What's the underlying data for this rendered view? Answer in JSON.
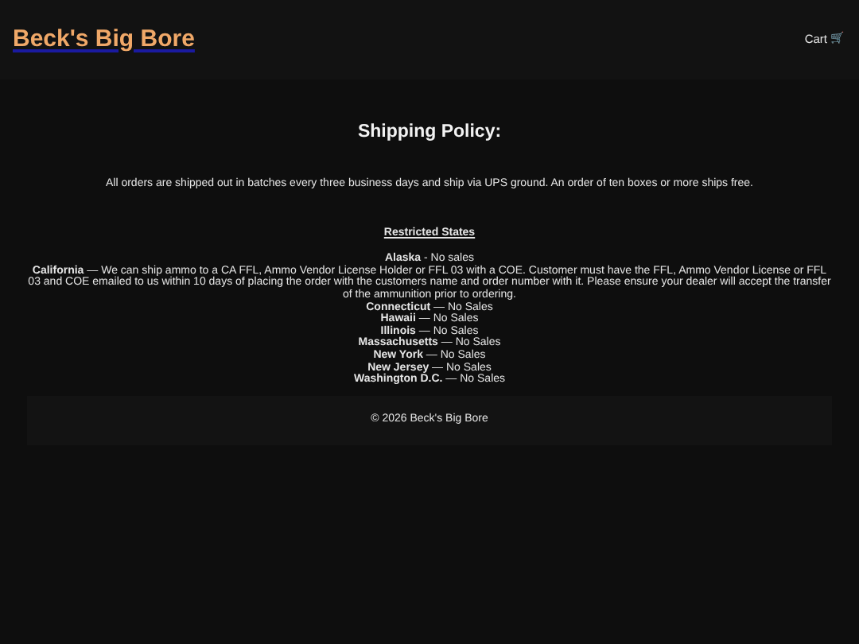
{
  "header": {
    "logo": "Beck's Big Bore",
    "cart": "Cart",
    "cart_icon": "🛒"
  },
  "title": "Shipping Policy:",
  "intro": "All orders are shipped out in batches every three business days and ship via UPS ground. An order of ten boxes or more ships free.",
  "restricted_heading": "Restricted States",
  "restrictions": [
    "**Alaska** - No sales",
    "**California** — We can ship ammo to a CA FFL, Ammo Vendor License Holder or FFL 03 with a COE. Customer must have the FFL, Ammo Vendor License or FFL 03 and COE emailed to us within 10 days of placing the order with the customers name and order number with it. Please ensure your dealer will accept the transfer of the ammunition prior to ordering.",
    "**Connecticut** — No Sales",
    "**Hawaii** — No Sales",
    "**Illinois** — No Sales",
    "**Massachusetts** — No Sales",
    "**New York** — No Sales",
    "**New Jersey** — No Sales",
    "**Washington D.C.** — No Sales"
  ],
  "footer": "© 2026 Beck's Big Bore"
}
